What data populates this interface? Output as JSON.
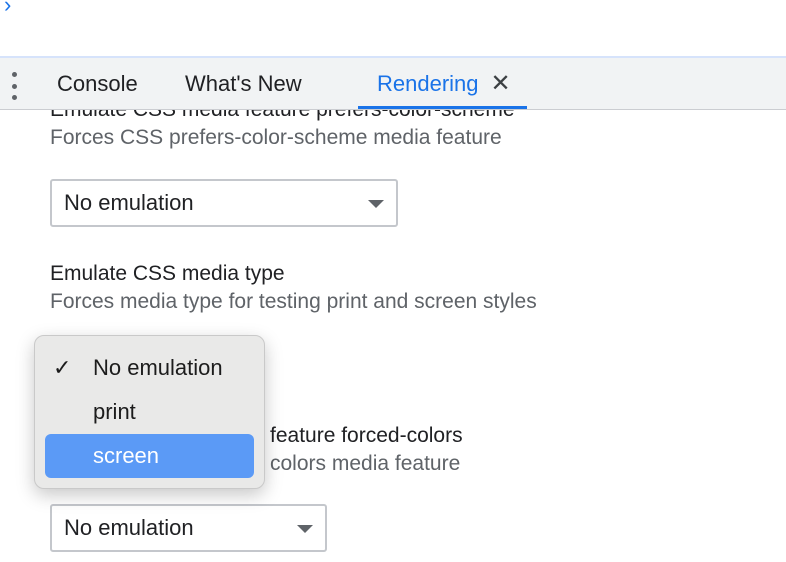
{
  "prompt": {
    "chevron": "›"
  },
  "tabs": [
    {
      "label": "Console"
    },
    {
      "label": "What's New"
    },
    {
      "label": "Rendering",
      "close": "✕"
    }
  ],
  "settings": {
    "color_scheme": {
      "title": "Emulate CSS media feature prefers-color-scheme",
      "desc": "Forces CSS prefers-color-scheme media feature",
      "value": "No emulation"
    },
    "media_type": {
      "title": "Emulate CSS media type",
      "desc": "Forces media type for testing print and screen styles"
    },
    "forced_colors": {
      "title_visible": "feature forced-colors",
      "desc_visible": "colors media feature",
      "value": "No emulation"
    }
  },
  "dropdown": {
    "check": "✓",
    "options": [
      "No emulation",
      "print",
      "screen"
    ],
    "selected": "No emulation",
    "highlighted": "screen"
  },
  "colors": {
    "accent": "#1a73e8",
    "highlight": "#5b9af6",
    "tab_bg": "#f1f3f4"
  }
}
